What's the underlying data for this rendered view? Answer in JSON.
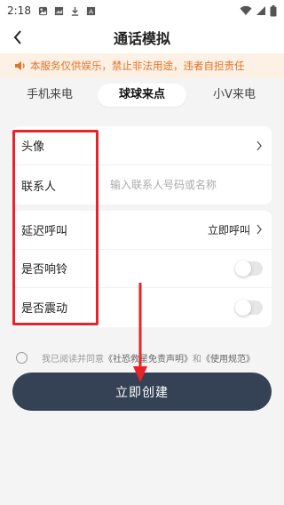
{
  "status_bar": {
    "time": "2:18",
    "icons": [
      "gallery-icon",
      "image-icon",
      "download-icon",
      "a-icon"
    ],
    "right_icons": [
      "wifi-icon",
      "signal-icon",
      "battery-icon"
    ]
  },
  "header": {
    "title": "通话模拟",
    "back_icon": "chevron-left-icon"
  },
  "notice": {
    "icon": "speaker-icon",
    "text": "本服务仅供娱乐，禁止非法用途，违者自担责任",
    "color": "#e0742a"
  },
  "tabs": [
    {
      "label": "手机来电",
      "active": false
    },
    {
      "label": "球球来点",
      "active": true
    },
    {
      "label": "小V来电",
      "active": false
    }
  ],
  "form": {
    "avatar_label": "头像",
    "contact_label": "联系人",
    "contact_placeholder": "输入联系人号码或名称",
    "delay_label": "延迟呼叫",
    "delay_value": "立即呼叫",
    "ring_label": "是否响铃",
    "ring_on": false,
    "vibrate_label": "是否震动",
    "vibrate_on": false
  },
  "agreement": {
    "prefix": "我已阅读并同意",
    "disclaimer": "《社恐救星免责声明》",
    "and": "和",
    "rules": "《使用规范》"
  },
  "create_button": {
    "label": "立即创建",
    "color": "#354255"
  },
  "annotation_color": "#e8232a"
}
